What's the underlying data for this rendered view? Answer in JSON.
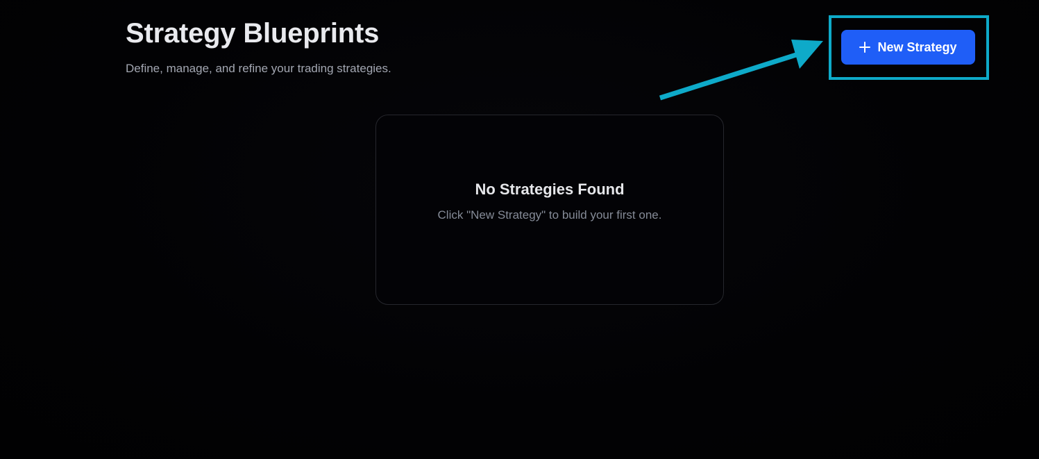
{
  "header": {
    "title": "Strategy Blueprints",
    "subtitle": "Define, manage, and refine your trading strategies."
  },
  "actions": {
    "new_strategy_label": "New Strategy",
    "new_strategy_icon": "plus-icon"
  },
  "empty_state": {
    "title": "No Strategies Found",
    "message": "Click \"New Strategy\" to build your first one."
  },
  "colors": {
    "background": "#020204",
    "primary_button": "#1f5ef7",
    "annotation": "#0eaac9"
  }
}
